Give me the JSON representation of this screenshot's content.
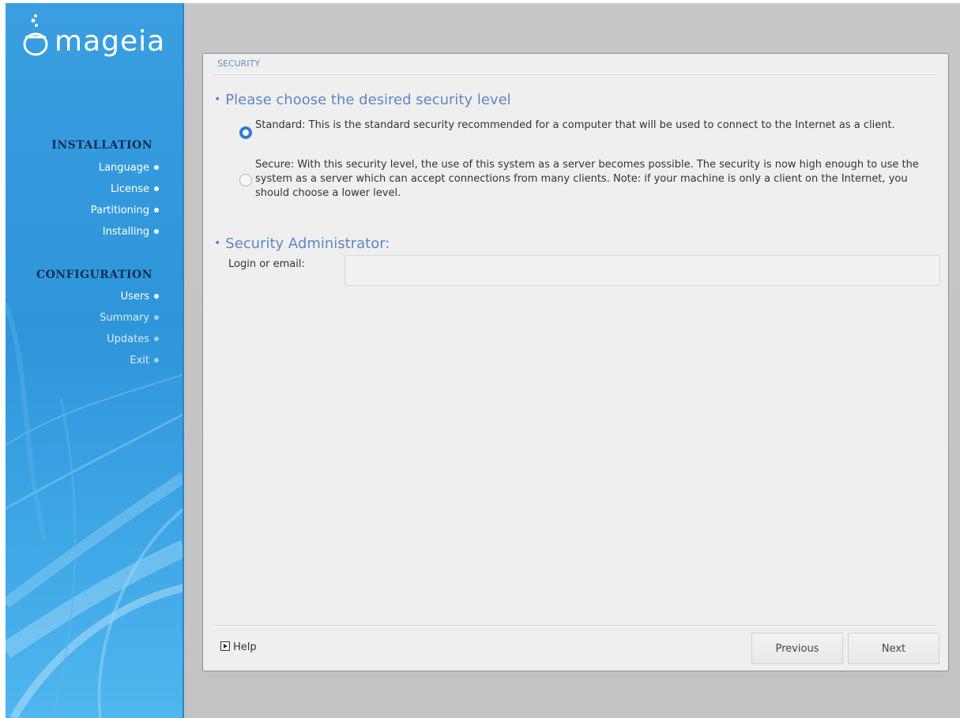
{
  "brand": {
    "name": "mageia"
  },
  "sidebar": {
    "installation_title": "INSTALLATION",
    "installation_items": [
      {
        "label": "Language",
        "state": "done"
      },
      {
        "label": "License",
        "state": "done"
      },
      {
        "label": "Partitioning",
        "state": "done"
      },
      {
        "label": "Installing",
        "state": "done"
      }
    ],
    "configuration_title": "CONFIGURATION",
    "configuration_items": [
      {
        "label": "Users",
        "state": "done"
      },
      {
        "label": "Summary",
        "state": "pending"
      },
      {
        "label": "Updates",
        "state": "pending"
      },
      {
        "label": "Exit",
        "state": "pending"
      }
    ]
  },
  "dialog": {
    "title": "SECURITY",
    "level_heading": "Please choose the desired security level",
    "options": [
      {
        "label": "Standard: This is the standard security recommended for a computer that will be used to connect to the Internet as a client.",
        "selected": true
      },
      {
        "label": "Secure: With this security level, the use of this system as a server becomes possible. The security is now high enough to use the system as a server which can accept connections from many clients. Note: if your machine is only a client on the Internet, you should choose a lower level.",
        "selected": false
      }
    ],
    "admin_heading": "Security Administrator:",
    "login_label": "Login or email:",
    "login_value": "",
    "help_label": "Help",
    "previous_label": "Previous",
    "next_label": "Next"
  },
  "colors": {
    "sidebar_blue": "#3a9fe0",
    "heading_blue": "#5f86c4",
    "radio_selected": "#2e7ad7"
  }
}
